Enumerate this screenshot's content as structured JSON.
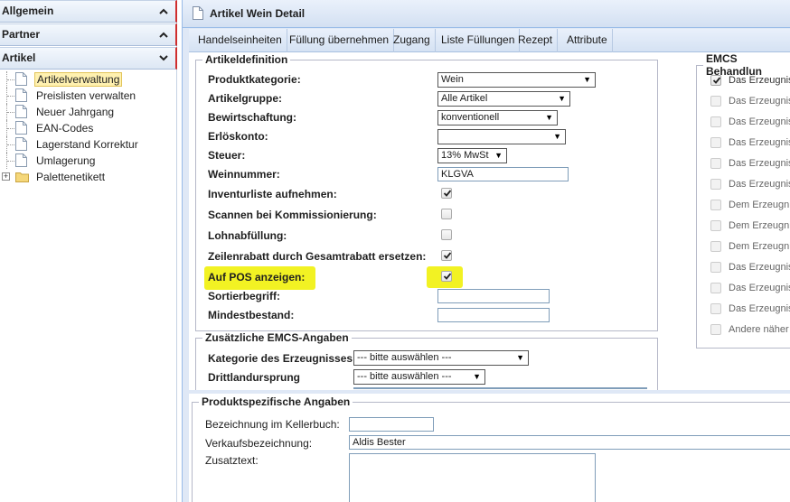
{
  "nav": {
    "sections": [
      {
        "label": "Allgemein"
      },
      {
        "label": "Partner"
      },
      {
        "label": "Artikel"
      }
    ],
    "tree_items": [
      {
        "label": "Artikelverwaltung"
      },
      {
        "label": "Preislisten verwalten"
      },
      {
        "label": "Neuer Jahrgang"
      },
      {
        "label": "EAN-Codes"
      },
      {
        "label": "Lagerstand Korrektur"
      },
      {
        "label": "Umlagerung"
      },
      {
        "label": "Palettenetikett"
      }
    ]
  },
  "panel": {
    "title": "Artikel Wein Detail"
  },
  "toolbar": {
    "buttons": [
      {
        "label": "Handelseinheiten"
      },
      {
        "label": "Füllung übernehmen"
      },
      {
        "label": "Zugang"
      },
      {
        "label": "Liste Füllungen"
      },
      {
        "label": "Rezept"
      },
      {
        "label": "Attribute"
      }
    ]
  },
  "artikeldefinition": {
    "legend": "Artikeldefinition",
    "fields": {
      "produktkategorie": {
        "label": "Produktkategorie:",
        "value": "Wein"
      },
      "artikelgruppe": {
        "label": "Artikelgruppe:",
        "value": "Alle Artikel"
      },
      "bewirtschaftung": {
        "label": "Bewirtschaftung:",
        "value": "konventionell"
      },
      "erloeskonto": {
        "label": "Erlöskonto:",
        "value": ""
      },
      "steuer": {
        "label": "Steuer:",
        "value": "13% MwSt"
      },
      "weinnummer": {
        "label": "Weinnummer:",
        "value": "KLGVA"
      },
      "inventurliste": {
        "label": "Inventurliste aufnehmen:",
        "checked": true
      },
      "scannen": {
        "label": "Scannen bei Kommissionierung:",
        "checked": false
      },
      "lohnabfuellung": {
        "label": "Lohnabfüllung:",
        "checked": false
      },
      "zeilenrabatt": {
        "label": "Zeilenrabatt durch Gesamtrabatt ersetzen:",
        "checked": true
      },
      "auf_pos": {
        "label": "Auf POS anzeigen:",
        "checked": true
      },
      "sortierbegriff": {
        "label": "Sortierbegriff:",
        "value": ""
      },
      "mindestbestand": {
        "label": "Mindestbestand:",
        "value": ""
      }
    }
  },
  "zusaetzliche_emcs": {
    "legend": "Zusätzliche EMCS-Angaben",
    "kategorie": {
      "label": "Kategorie des Erzeugnisses",
      "value": "--- bitte auswählen ---"
    },
    "drittland": {
      "label": "Drittlandursprung",
      "value": "--- bitte auswählen ---"
    }
  },
  "emcs_behandlung": {
    "legend": "EMCS Behandlun",
    "items": [
      {
        "label": "Das Erzeugnis",
        "checked": true
      },
      {
        "label": "Das Erzeugnis",
        "checked": false
      },
      {
        "label": "Das Erzeugnis",
        "checked": false
      },
      {
        "label": "Das Erzeugnis",
        "checked": false
      },
      {
        "label": "Das Erzeugnis",
        "checked": false
      },
      {
        "label": "Das Erzeugnis",
        "checked": false
      },
      {
        "label": "Dem Erzeugni",
        "checked": false
      },
      {
        "label": "Dem Erzeugni",
        "checked": false
      },
      {
        "label": "Dem Erzeugni",
        "checked": false
      },
      {
        "label": "Das Erzeugnis",
        "checked": false
      },
      {
        "label": "Das Erzeugnis",
        "checked": false
      },
      {
        "label": "Das Erzeugnis",
        "checked": false
      },
      {
        "label": "Andere näher",
        "checked": false
      }
    ]
  },
  "produktspezifisch": {
    "legend": "Produktspezifische Angaben",
    "kellerbuch": {
      "label": "Bezeichnung im Kellerbuch:",
      "value": ""
    },
    "verkauf": {
      "label": "Verkaufsbezeichnung:",
      "value": "Aldis Bester"
    },
    "zusatztext": {
      "label": "Zusatztext:",
      "value": ""
    }
  },
  "colors": {
    "highlight": "#f2f223",
    "panel_bg": "#dfe8f6",
    "header_text": "#1e1e1e",
    "nav_accent": "#cf2e2e"
  }
}
